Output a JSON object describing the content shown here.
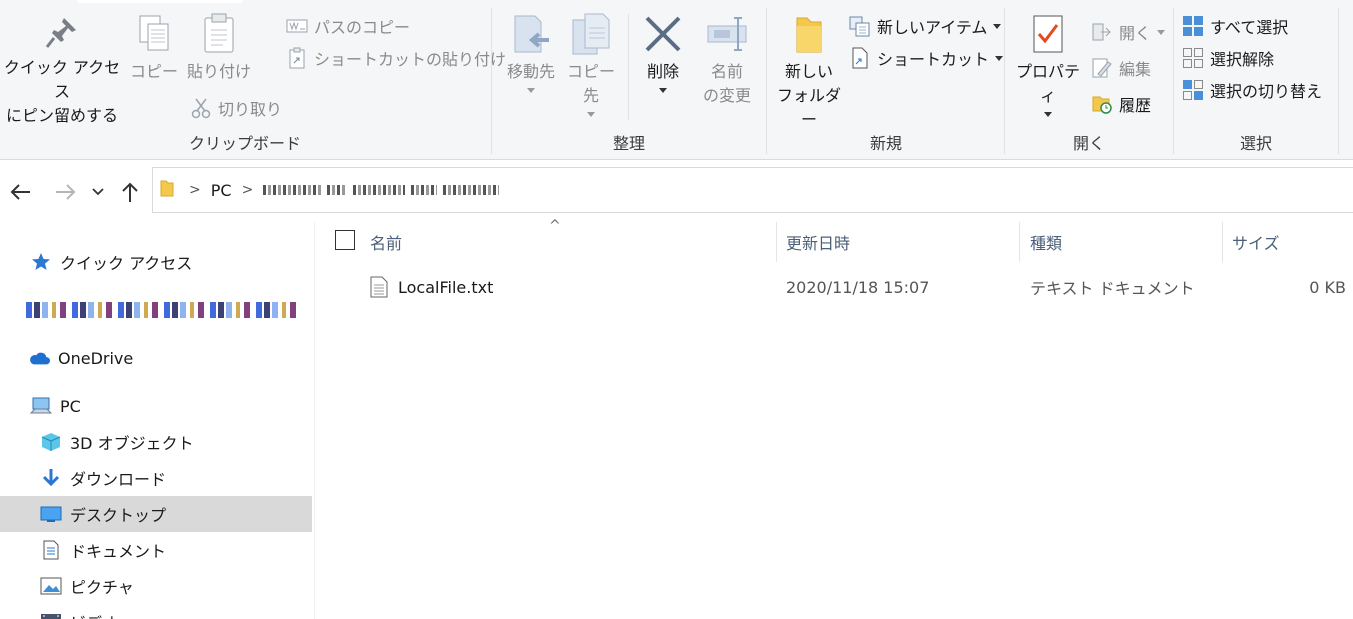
{
  "ribbon": {
    "clipboard": {
      "label": "クリップボード",
      "pin_line1": "クイック アクセス",
      "pin_line2": "にピン留めする",
      "copy": "コピー",
      "paste": "貼り付け",
      "cut": "切り取り",
      "copy_path": "パスのコピー",
      "paste_shortcut": "ショートカットの貼り付け"
    },
    "organize": {
      "label": "整理",
      "move_to": "移動先",
      "copy_to": "コピー先",
      "delete": "削除",
      "rename_line1": "名前",
      "rename_line2": "の変更"
    },
    "new": {
      "label": "新規",
      "new_folder_line1": "新しい",
      "new_folder_line2": "フォルダー",
      "new_item": "新しいアイテム",
      "shortcut": "ショートカット"
    },
    "open": {
      "label": "開く",
      "properties": "プロパティ",
      "open": "開く",
      "edit": "編集",
      "history": "履歴"
    },
    "select": {
      "label": "選択",
      "select_all": "すべて選択",
      "select_none": "選択解除",
      "invert": "選択の切り替え"
    }
  },
  "address": {
    "root": "PC"
  },
  "navpane": {
    "items": [
      {
        "label": "クイック アクセス",
        "icon": "star-icon"
      },
      {
        "label": "OneDrive",
        "icon": "cloud-icon"
      },
      {
        "label": "PC",
        "icon": "computer-icon"
      },
      {
        "label": "3D オブジェクト",
        "icon": "cube-icon"
      },
      {
        "label": "ダウンロード",
        "icon": "download-icon"
      },
      {
        "label": "デスクトップ",
        "icon": "desktop-icon"
      },
      {
        "label": "ドキュメント",
        "icon": "document-icon"
      },
      {
        "label": "ピクチャ",
        "icon": "picture-icon"
      },
      {
        "label": "ビデオ",
        "icon": "video-icon"
      }
    ],
    "selected": "デスクトップ"
  },
  "filelist": {
    "columns": {
      "name": "名前",
      "modified": "更新日時",
      "type": "種類",
      "size": "サイズ"
    },
    "rows": [
      {
        "name": "LocalFile.txt",
        "modified": "2020/11/18 15:07",
        "type": "テキスト ドキュメント",
        "size": "0 KB"
      }
    ]
  },
  "colors": {
    "accent_blue": "#2b78d3",
    "selected_bg": "#d9d9d9",
    "ribbon_bg": "#f5f6f7",
    "delete_x": "#5a6d85",
    "folder_yellow": "#f4c84a"
  }
}
